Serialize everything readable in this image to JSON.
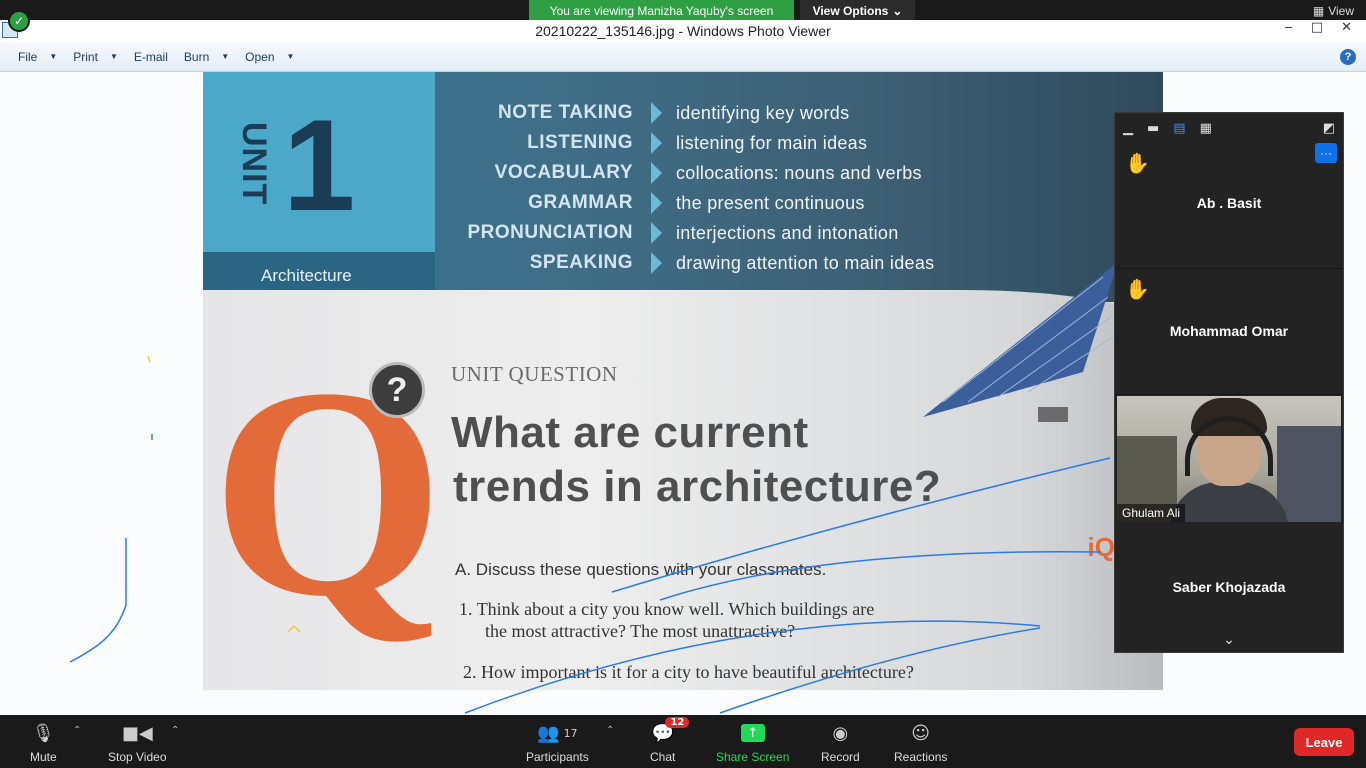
{
  "banner": {
    "viewing_text": "You are viewing Manizha Yaquby's screen",
    "view_options_label": "View Options",
    "view_label": "View"
  },
  "window": {
    "title": "20210222_135146.jpg - Windows Photo Viewer",
    "minimize": "‒",
    "maximize": "□",
    "close": "✕"
  },
  "menu": {
    "items": [
      {
        "label": "File",
        "has_caret": true
      },
      {
        "label": "Print",
        "has_caret": true
      },
      {
        "label": "E-mail",
        "has_caret": false
      },
      {
        "label": "Burn",
        "has_caret": true
      },
      {
        "label": "Open",
        "has_caret": true
      }
    ],
    "help_label": "?"
  },
  "photo": {
    "unit_word": "UNIT",
    "unit_number": "1",
    "unit_topic": "Architecture",
    "skills": [
      {
        "name": "NOTE TAKING",
        "desc": "identifying key words"
      },
      {
        "name": "LISTENING",
        "desc": "listening for main ideas"
      },
      {
        "name": "VOCABULARY",
        "desc": "collocations: nouns and verbs"
      },
      {
        "name": "GRAMMAR",
        "desc": "the present continuous"
      },
      {
        "name": "PRONUNCIATION",
        "desc": "interjections and intonation"
      },
      {
        "name": "SPEAKING",
        "desc": "drawing attention to main ideas"
      }
    ],
    "q_letter": "Q",
    "q_badge": "?",
    "unit_question_label": "UNIT QUESTION",
    "question_line1": "What are current",
    "question_line2": "trends in architecture?",
    "discuss_prefix": "A.",
    "discuss_text": "Discuss these questions with your classmates.",
    "item1_num": "1.",
    "item1_line1": "Think about a city you know well. Which buildings are",
    "item1_line2": "the most attractive? The most unattractive?",
    "item2_num": "2.",
    "item2_text": "How important is it for a city to have beautiful architecture?",
    "corner_logo": "iQ"
  },
  "panel": {
    "participants": [
      {
        "name": "Ab . Basit",
        "hand_raised": true
      },
      {
        "name": "Mohammad Omar",
        "hand_raised": true
      },
      {
        "name": "Ghulam Ali",
        "video": true
      },
      {
        "name": "Saber Khojazada",
        "hand_raised": false
      }
    ],
    "more_label": "···"
  },
  "toolbar": {
    "mute": "Mute",
    "stop_video": "Stop Video",
    "participants": "Participants",
    "participants_count": "17",
    "chat": "Chat",
    "chat_badge": "12",
    "share_screen": "Share Screen",
    "record": "Record",
    "reactions": "Reactions",
    "leave": "Leave"
  },
  "colors": {
    "zoom_green": "#23d959",
    "zoom_red": "#e02828",
    "zoom_blue": "#0e71eb",
    "book_orange": "#e36b3a",
    "book_teal": "#4ba8c9",
    "annotation_blue": "#2a7be4"
  }
}
